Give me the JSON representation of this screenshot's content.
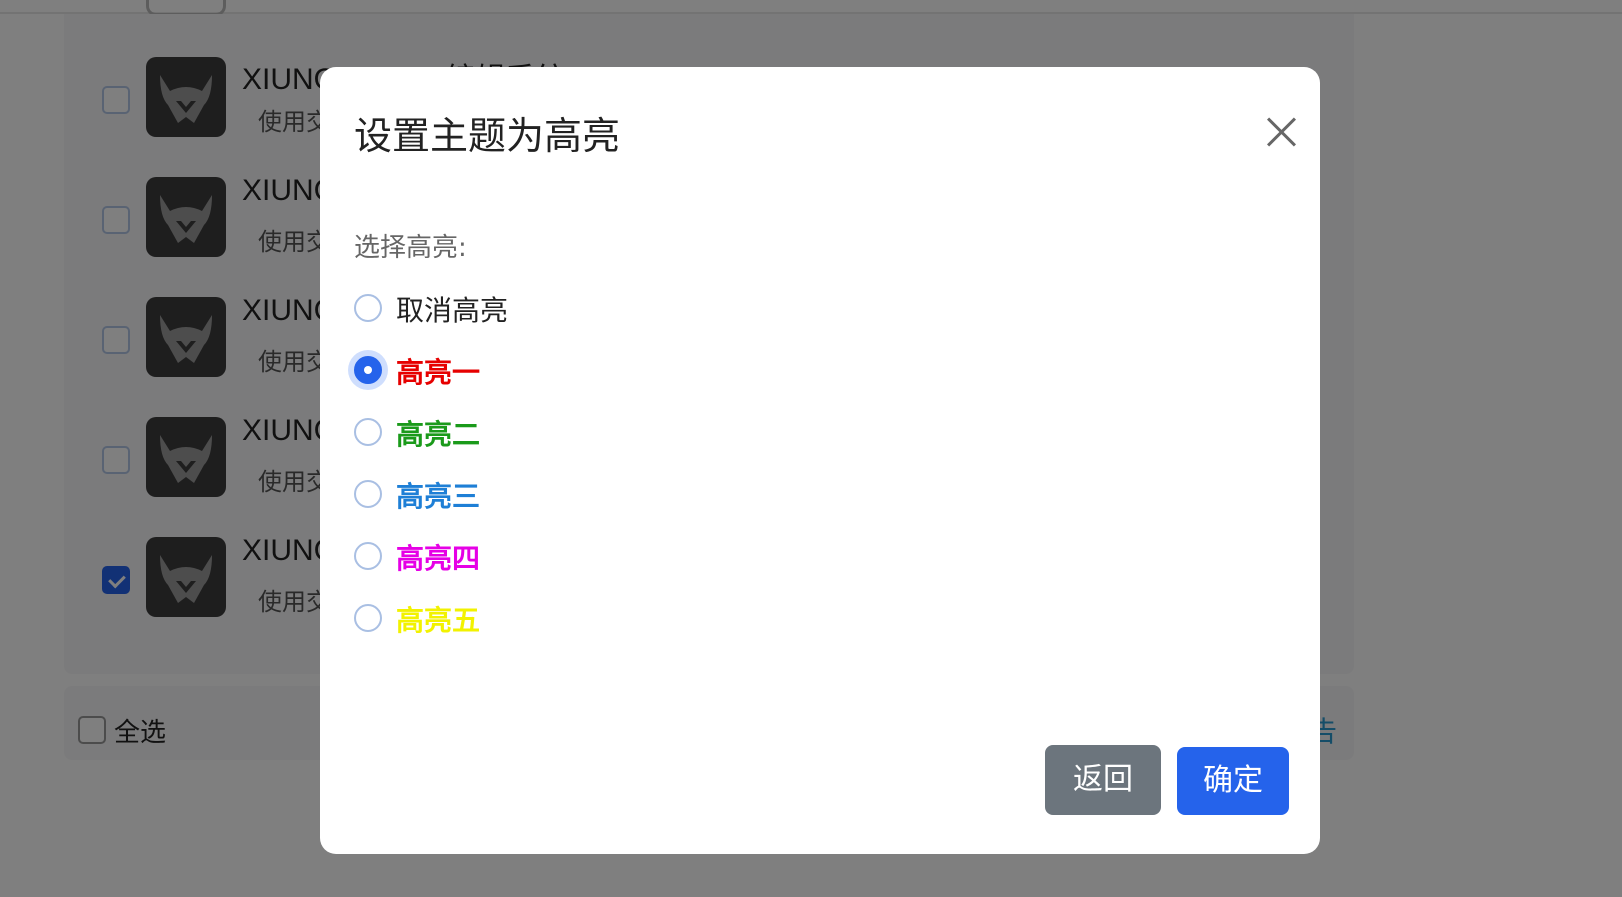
{
  "background": {
    "list_items": [
      {
        "name": "XIUNOX Code 编辑系统",
        "desc": "使用交",
        "checked": false
      },
      {
        "name": "XIUNC",
        "desc": "使用交",
        "checked": false
      },
      {
        "name": "XIUNC",
        "desc": "使用交",
        "checked": false
      },
      {
        "name": "XIUNC",
        "desc": "使用交",
        "checked": false
      },
      {
        "name": "XIUNC",
        "desc": "使用交",
        "checked": true
      }
    ],
    "select_all_label": "全选",
    "footer_link_partial": "告"
  },
  "modal": {
    "title": "设置主题为高亮",
    "section_label": "选择高亮:",
    "options": [
      {
        "label": "取消高亮",
        "color": "#222222",
        "bold": false,
        "selected": false
      },
      {
        "label": "高亮一",
        "color": "#e60000",
        "bold": true,
        "selected": true
      },
      {
        "label": "高亮二",
        "color": "#1a9a1a",
        "bold": true,
        "selected": false
      },
      {
        "label": "高亮三",
        "color": "#1e7fd6",
        "bold": true,
        "selected": false
      },
      {
        "label": "高亮四",
        "color": "#e600e6",
        "bold": true,
        "selected": false
      },
      {
        "label": "高亮五",
        "color": "#f2f200",
        "bold": true,
        "selected": false
      }
    ],
    "back_label": "返回",
    "confirm_label": "确定"
  }
}
